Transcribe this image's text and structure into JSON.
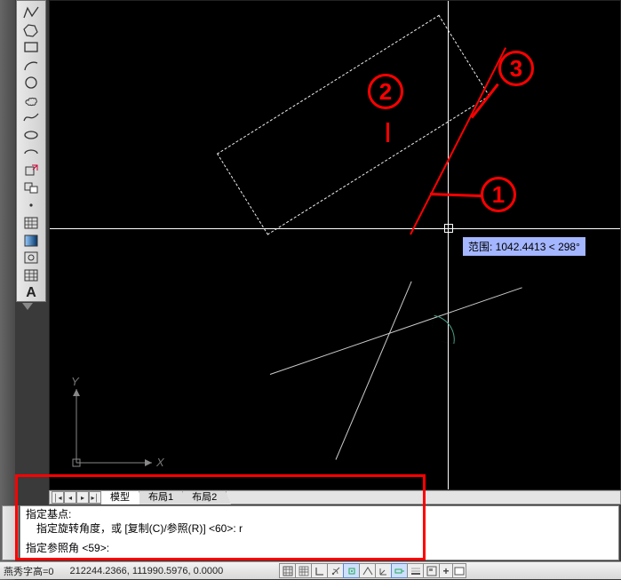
{
  "tooltip": {
    "text": "范围: 1042.4413 < 298°"
  },
  "callouts": {
    "c1": "1",
    "c2": "2",
    "c3": "3"
  },
  "ucs": {
    "x": "X",
    "y": "Y"
  },
  "tabs": {
    "model": "模型",
    "layout1": "布局1",
    "layout2": "布局2"
  },
  "command_lines": {
    "l1": "指定基点:",
    "l2": "指定旋转角度，或 [复制(C)/参照(R)] <60>:  r",
    "l3": "指定参照角 <59>:"
  },
  "status": {
    "textstyle_label": "燕秀字高=0",
    "coords": "212244.2366, 111990.5976, 0.0000",
    "plus": "+"
  }
}
